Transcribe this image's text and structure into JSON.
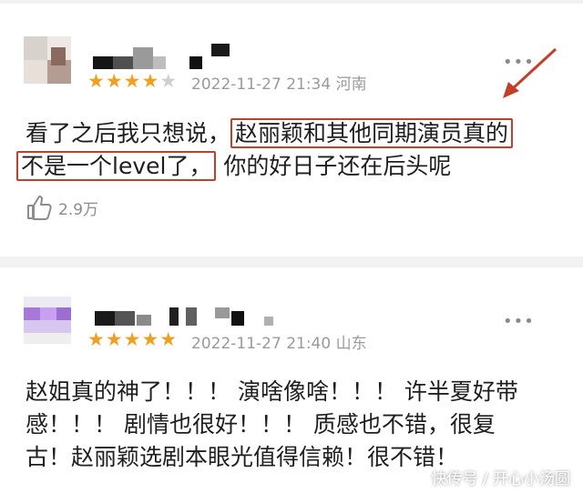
{
  "comments": [
    {
      "rating": 4,
      "date": "2022-11-27 21:34",
      "location": "河南",
      "more_icon": "more-dots-icon",
      "line1_plain": "看了之后我只想说，",
      "line1_highlight": "赵丽颖和其他同期演员真的",
      "line2_highlight": "不是一个level了，",
      "line2_plain": "你的好日子还在后头呢",
      "likes": "2.9万",
      "like_icon": "thumbs-up-icon"
    },
    {
      "rating": 5,
      "date": "2022-11-27 21:40",
      "location": "山东",
      "more_icon": "more-dots-icon",
      "lines": [
        "赵姐真的神了！！！ 演啥像啥！！！ 许半夏好带",
        "感！！！ 剧情也很好！！！ 质感也不错，很复",
        "古！赵丽颖选剧本眼光值得信赖！很不错！"
      ]
    }
  ],
  "watermark": "快传号 / 开心小汤圆",
  "colors": {
    "star": "#f0a020",
    "star_empty": "#d0d0d0",
    "highlight_box": "#c2402a",
    "arrow": "#c2402a",
    "meta_text": "#9a9a9a"
  }
}
